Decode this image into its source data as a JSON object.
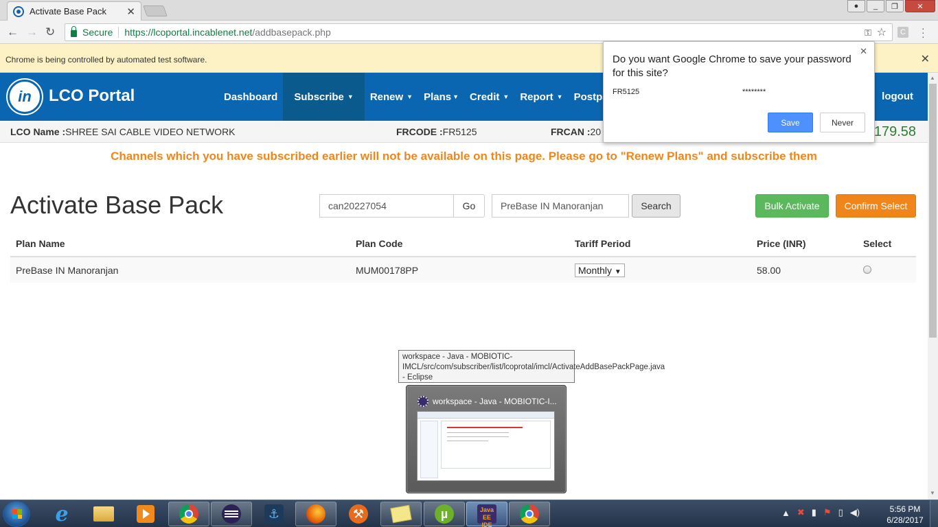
{
  "browser": {
    "tab_title": "Activate Base Pack",
    "tab_close": "✕",
    "secure_label": "Secure",
    "url_host": "https://lcoportal.incablenet.net",
    "url_path": "/addbasepack.php",
    "infobar_text": "Chrome is being controlled by automated test software.",
    "infobar_close": "✕",
    "ext_letter": "C"
  },
  "password_bubble": {
    "question": "Do you want Google Chrome to save your password for this site?",
    "username": "FR5125",
    "password_masked": "********",
    "save_label": "Save",
    "never_label": "Never",
    "close": "✕"
  },
  "portal": {
    "logo_text": "in",
    "brand": "LCO Portal",
    "nav": {
      "dashboard": "Dashboard",
      "subscribe": "Subscribe",
      "renew": "Renew",
      "plans": "Plans",
      "credit": "Credit",
      "report": "Report",
      "postpaid": "Postpaid",
      "logout": "logout"
    },
    "lco_name_label": "LCO Name :",
    "lco_name_value": "SHREE SAI CABLE VIDEO NETWORK",
    "frcode_label": "FRCODE :",
    "frcode_value": "FR5125",
    "frcan_label": "FRCAN :",
    "frcan_value": "20",
    "balance": "179.58",
    "notice": "Channels which you have subscribed earlier will not be available on this page. Please go to \"Renew Plans\" and subscribe them"
  },
  "page": {
    "title": "Activate Base Pack",
    "can_input_value": "can20227054",
    "go_label": "Go",
    "search_input_value": "PreBase IN Manoranjan",
    "search_label": "Search",
    "bulk_activate_label": "Bulk Activate",
    "confirm_select_label": "Confirm Select"
  },
  "table": {
    "headers": [
      "Plan Name",
      "Plan Code",
      "Tariff Period",
      "Price (INR)",
      "Select"
    ],
    "rows": [
      {
        "plan_name": "PreBase IN Manoranjan",
        "plan_code": "MUM00178PP",
        "tariff": "Monthly",
        "price": "58.00"
      }
    ]
  },
  "taskbar": {
    "tooltip": "workspace - Java - MOBIOTIC-IMCL/src/com/subscriber/list/lcoprotal/imcl/ActivateAddBasePackPage.java - Eclipse",
    "thumb_title": "workspace - Java - MOBIOTIC-I...",
    "javaee_label": "Java EE IDE",
    "clock_time": "5:56 PM",
    "clock_date": "6/28/2017"
  }
}
